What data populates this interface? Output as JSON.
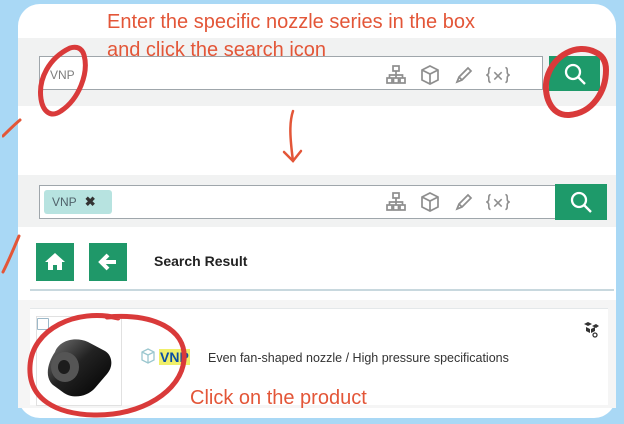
{
  "instructions": {
    "search_line1": "Enter the specific nozzle series in the box",
    "search_line2": "and click the search icon",
    "click_product": "Click on the product"
  },
  "top_search": {
    "value": "VNP"
  },
  "lower_search": {
    "tag_label": "VNP",
    "tag_remove": "✖"
  },
  "nav": {
    "title": "Search Result"
  },
  "product": {
    "series": "VNP",
    "description": "Even fan-shaped nozzle / High pressure specifications"
  },
  "colors": {
    "accent_green": "#1f9869",
    "annotation_red": "#e35638",
    "annotation_circle": "#d93a3a",
    "background": "#a9d8f5",
    "tag_bg": "#b7e3e0",
    "highlight": "#f0ef6a"
  },
  "icons": [
    "hierarchy-icon",
    "cube-icon",
    "pencil-icon",
    "variable-icon",
    "search-icon",
    "home-icon",
    "arrow-left-icon",
    "product-image",
    "eye-icon"
  ]
}
